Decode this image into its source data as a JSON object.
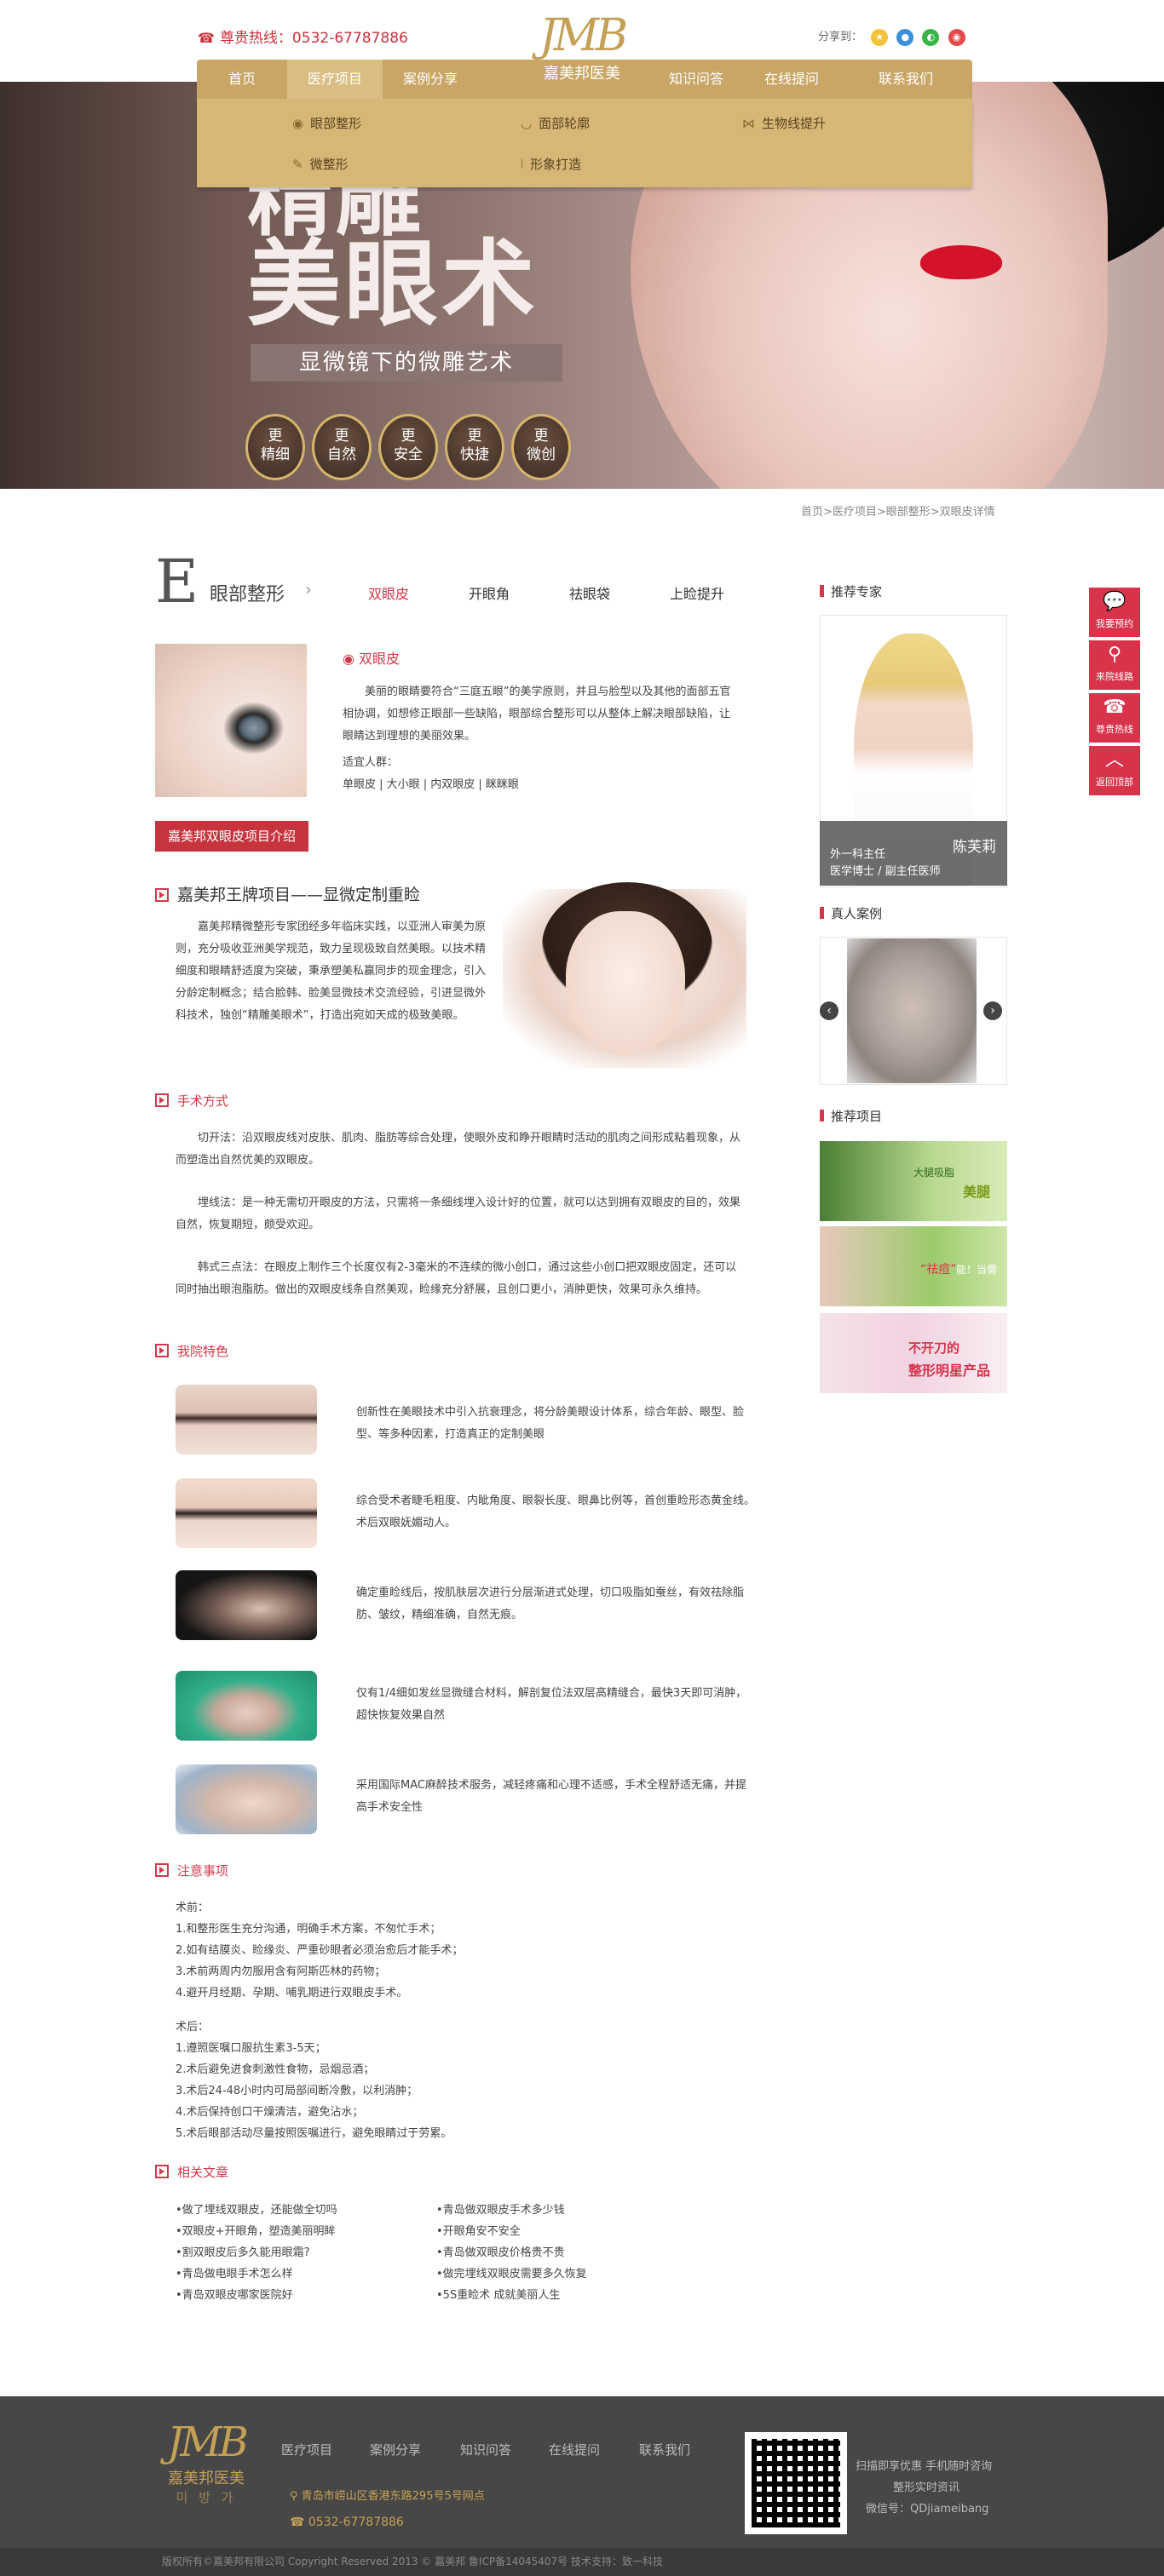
{
  "header": {
    "hotline_label": "尊贵热线：0532-67787886",
    "logo_mark": "JMB",
    "logo_name": "嘉美邦医美",
    "share_label": "分享到："
  },
  "nav": {
    "items": [
      "首页",
      "医疗项目",
      "案例分享",
      "知识问答",
      "在线提问",
      "联系我们"
    ],
    "active": "医疗项目"
  },
  "submenu": {
    "items": [
      "眼部整形",
      "面部轮廓",
      "生物线提升",
      "微整形",
      "形象打造"
    ]
  },
  "banner": {
    "headline_1": "精雕",
    "headline_2": "美眼术",
    "subtitle": "显微镜下的微雕艺术",
    "drops": [
      {
        "top": "更",
        "bottom": "精细"
      },
      {
        "top": "更",
        "bottom": "自然"
      },
      {
        "top": "更",
        "bottom": "安全"
      },
      {
        "top": "更",
        "bottom": "快捷"
      },
      {
        "top": "更",
        "bottom": "微创"
      }
    ]
  },
  "breadcrumb": "首页>医疗项目>眼部整形>双眼皮详情",
  "category": {
    "letter": "E",
    "name": "眼部整形",
    "tabs": [
      "双眼皮",
      "开眼角",
      "祛眼袋",
      "上睑提升"
    ],
    "active_tab": "双眼皮"
  },
  "intro": {
    "title": "双眼皮",
    "paragraph": "美丽的眼睛要符合“三庭五眼”的美学原则，并且与脸型以及其他的面部五官相协调，如想修正眼部一些缺陷，眼部综合整形可以从整体上解决眼部缺陷，让眼睛达到理想的美丽效果。",
    "suitable_label": "适宜人群：",
    "suitable_list": "单眼皮 | 大小眼 | 内双眼皮 | 眯眯眼",
    "button_label": "嘉美邦双眼皮项目介绍"
  },
  "wangpai": {
    "title": "嘉美邦王牌项目——显微定制重睑",
    "paragraph": "嘉美邦精微整形专家团经多年临床实践，以亚洲人审美为原则，充分吸收亚洲美学规范，致力呈现极致自然美眼。以技术精细度和眼睛舒适度为突破，秉承塑美私赢同步的现金理念，引入分龄定制概念；结合脸韩、脸美显微技术交流经验，引进显微外科技术，独创“精雕美眼术”，打造出宛如天成的极致美眼。"
  },
  "methods": {
    "heading": "手术方式",
    "items": [
      "切开法：沿双眼皮线对皮肤、肌肉、脂肪等综合处理，使眼外皮和睁开眼睛时活动的肌肉之间形成粘着现象，从而塑造出自然优美的双眼皮。",
      "埋线法：是一种无需切开眼皮的方法，只需将一条细线埋入设计好的位置，就可以达到拥有双眼皮的目的，效果自然，恢复期短，颇受欢迎。",
      "韩式三点法：在眼皮上制作三个长度仅有2-3毫米的不连续的微小创口，通过这些小创口把双眼皮固定，还可以同时抽出眼泡脂肪。做出的双眼皮线条自然美观，睑缘充分舒展，且创口更小，消肿更快，效果可永久维持。"
    ]
  },
  "features": {
    "heading": "我院特色",
    "items": [
      "创新性在美眼技术中引入抗衰理念，将分龄美眼设计体系，综合年龄、眼型、脸型、等多种因素，打造真正的定制美眼",
      "综合受术者睫毛粗度、内眦角度、眼裂长度、眼鼻比例等，首创重睑形态黄金线。术后双眼妩媚动人。",
      "确定重睑线后，按肌肤层次进行分层渐进式处理，切口吸脂如蚕丝，有效祛除脂肪、皱纹，精细准确，自然无痕。",
      "仅有1/4细如发丝显微缝合材料，解剖复位法双层高精缝合，最快3天即可消肿，超快恢复效果自然",
      "采用国际MAC麻醉技术服务，减轻疼痛和心理不适感，手术全程舒适无痛，并提高手术安全性"
    ]
  },
  "notes": {
    "heading": "注意事项",
    "before_label": "术前：",
    "before": [
      "1.和整形医生充分沟通，明确手术方案，不匆忙手术；",
      "2.如有结膜炎、睑缘炎、严重砂眼者必须治愈后才能手术；",
      "3.术前两周内勿服用含有阿斯匹林的药物；",
      "4.避开月经期、孕期、哺乳期进行双眼皮手术。"
    ],
    "after_label": "术后：",
    "after": [
      "1.遵照医嘱口服抗生素3-5天；",
      "2.术后避免进食刺激性食物，忌烟忌酒；",
      "3.术后24-48小时内可局部间断冷敷，以利消肿；",
      "4.术后保持创口干燥清洁，避免沾水；",
      "5.术后眼部活动尽量按照医嘱进行，避免眼睛过于劳累。"
    ]
  },
  "articles": {
    "heading": "相关文章",
    "left": [
      "•做了埋线双眼皮，还能做全切吗",
      "•双眼皮+开眼角，塑造美丽明眸",
      "•割双眼皮后多久能用眼霜?",
      "•青岛做电眼手术怎么样",
      "•青岛双眼皮哪家医院好"
    ],
    "right": [
      "•青岛做双眼皮手术多少钱",
      "•开眼角安不安全",
      "•青岛做双眼皮价格贵不贵",
      "•做完埋线双眼皮需要多久恢复",
      "•5S重睑术 成就美丽人生"
    ]
  },
  "sidebar": {
    "expert_heading": "推荐专家",
    "doctor_name": "陈芙莉",
    "doctor_title": "外一科主任",
    "doctor_degree": "医学博士 / 副主任医师",
    "case_heading": "真人案例",
    "recommend_heading": "推荐项目",
    "rec_items": [
      {
        "tag": "大腿吸脂",
        "word": "美腿",
        "bg": "#b9d88f"
      },
      {
        "tag": "“祛痘”",
        "word": "能！当需",
        "bg": "#9ccb6b"
      },
      {
        "tag": "不开刀的",
        "word": "整形明星产品",
        "bg": "#f0d3e1"
      }
    ]
  },
  "float_bar": [
    "我要预约",
    "来院线路",
    "尊贵热线",
    "返回顶部"
  ],
  "footer": {
    "logo_mark": "JMB",
    "logo_name": "嘉美邦医美",
    "logo_korean": "미 방 가",
    "nav": [
      "医疗项目",
      "案例分享",
      "知识问答",
      "在线提问",
      "联系我们"
    ],
    "address": "青岛市崂山区香港东路295号5号网点",
    "phone": "0532-67787886",
    "qr_lines": [
      "扫描即享优惠 手机随时咨询",
      "整形实时资讯",
      "微信号：QDjiameibang"
    ],
    "copyright": "版权所有©嘉美邦有限公司    Copyright Reserved 2013 © 嘉美邦    鲁ICP备14045407号    技术支持：致一科技"
  },
  "colors": {
    "accent": "#d1394b",
    "gold": "#c9a665",
    "gold_light": "#d7b775"
  }
}
